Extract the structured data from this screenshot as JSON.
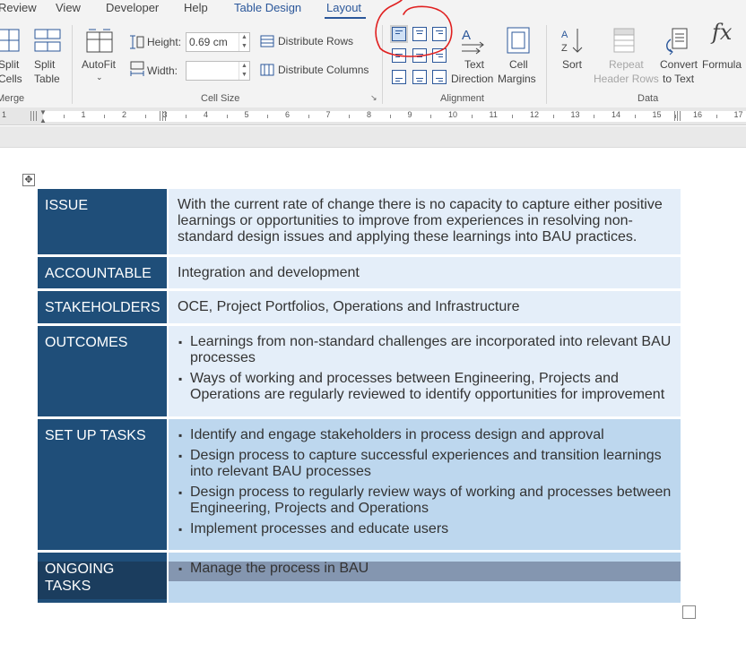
{
  "tabs": [
    "Review",
    "View",
    "Developer",
    "Help",
    "Table Design",
    "Layout"
  ],
  "merge": {
    "split_cells": [
      "Split",
      "Cells"
    ],
    "split_table": [
      "Split",
      "Table"
    ],
    "group_label": "Merge"
  },
  "cell_size": {
    "autofit_label": "AutoFit",
    "height_label": "Height:",
    "height_value": "0.69 cm",
    "width_label": "Width:",
    "width_value": "",
    "distribute_rows": "Distribute Rows",
    "distribute_columns": "Distribute Columns",
    "group_label": "Cell Size"
  },
  "alignment": {
    "text_direction": [
      "Text",
      "Direction"
    ],
    "cell_margins": [
      "Cell",
      "Margins"
    ],
    "group_label": "Alignment",
    "selected": "top-left"
  },
  "data_group": {
    "sort": "Sort",
    "repeat_header_rows": [
      "Repeat",
      "Header Rows"
    ],
    "convert_to_text": [
      "Convert",
      "to Text"
    ],
    "formula": "Formula",
    "group_label": "Data"
  },
  "ruler_numbers": [
    "1",
    "1",
    "2",
    "3",
    "4",
    "5",
    "6",
    "7",
    "8",
    "9",
    "10",
    "11",
    "12",
    "13",
    "14",
    "15",
    "16",
    "17"
  ],
  "table": {
    "rows": [
      {
        "header": "ISSUE",
        "content": "With the current rate of change there is no capacity to capture either positive learnings or opportunities to improve from experiences in resolving non-standard design issues and applying these learnings into BAU practices."
      },
      {
        "header": "ACCOUNTABLE",
        "content": "Integration and development"
      },
      {
        "header": "STAKEHOLDERS",
        "content": "OCE, Project Portfolios, Operations and Infrastructure"
      },
      {
        "header": "OUTCOMES",
        "bullets": [
          "Learnings from non-standard challenges are incorporated into relevant BAU processes",
          "Ways of working and processes between Engineering, Projects and Operations are regularly reviewed to identify opportunities for improvement"
        ]
      },
      {
        "header": "SET UP TASKS",
        "bullets": [
          "Identify and engage stakeholders in process design and approval",
          "Design process to capture successful experiences and transition learnings into relevant BAU processes",
          "Design process to regularly review ways of working and processes between Engineering, Projects and Operations",
          "Implement processes and educate users"
        ]
      },
      {
        "header": "ONGOING TASKS",
        "bullets": [
          "Manage the process in BAU"
        ]
      }
    ]
  },
  "colors": {
    "header_bg": "#1f4e79",
    "light_cell": "#e4eef9",
    "dark_cell": "#bdd7ee",
    "selection": "#8496b0",
    "annotation": "#e02020",
    "accent": "#2b579a"
  }
}
